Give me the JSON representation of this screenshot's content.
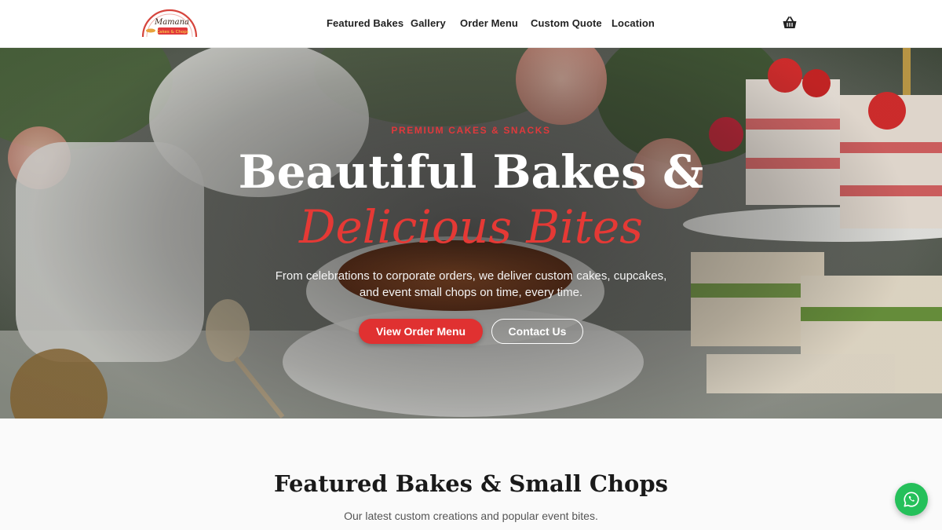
{
  "logo": {
    "line1": "Mamana",
    "line2": "Cakes & Chops"
  },
  "nav": {
    "items": [
      {
        "label": "Featured Bakes"
      },
      {
        "label": "Gallery"
      },
      {
        "label": "Order Menu"
      },
      {
        "label": "Custom Quote"
      },
      {
        "label": "Location"
      }
    ],
    "cart_icon": "basket-icon"
  },
  "hero": {
    "eyebrow": "PREMIUM CAKES & SNACKS",
    "headline_line1": "Beautiful Bakes &",
    "headline_line2": "Delicious Bites",
    "subtext": "From celebrations to corporate orders, we deliver custom cakes, cupcakes, and event small chops on time, every time.",
    "primary_button": "View Order Menu",
    "secondary_button": "Contact Us"
  },
  "featured": {
    "title": "Featured Bakes & Small Chops",
    "subtitle": "Our latest custom creations and popular event bites."
  },
  "whatsapp": {
    "icon": "whatsapp-icon"
  },
  "colors": {
    "accent": "#e03131",
    "whatsapp": "#25c05a",
    "header_bg": "#ffffff",
    "section_bg": "#fafafa"
  }
}
